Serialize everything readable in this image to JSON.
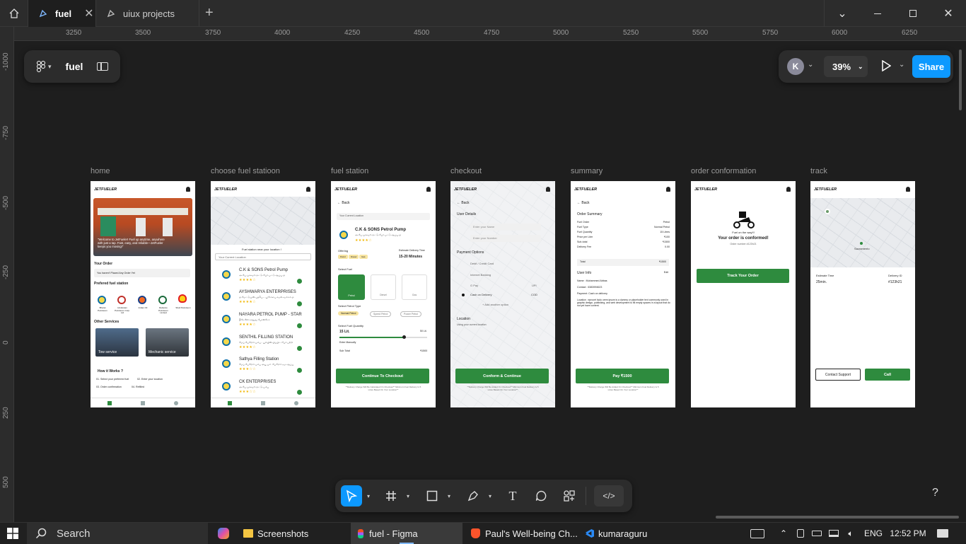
{
  "tabs": [
    {
      "label": "fuel"
    },
    {
      "label": "uiux projects"
    }
  ],
  "ruler": {
    "top": [
      "3250",
      "3500",
      "3750",
      "4000",
      "4250",
      "4500",
      "4750",
      "5000",
      "5250",
      "5500",
      "5750",
      "6000",
      "6250"
    ],
    "left": [
      "-1000",
      "-750",
      "-500",
      "-250",
      "0",
      "250",
      "500"
    ]
  },
  "file": {
    "name": "fuel"
  },
  "right_toolbar": {
    "avatar": "K",
    "zoom": "39%",
    "share": "Share"
  },
  "frames": [
    {
      "label": "home"
    },
    {
      "label": "choose fuel statioon"
    },
    {
      "label": "fuel station"
    },
    {
      "label": "checkout"
    },
    {
      "label": "summary"
    },
    {
      "label": "order conformation"
    },
    {
      "label": "track"
    }
  ],
  "brand": "JETFUELER",
  "home": {
    "hero": "\"Welcome to JetFueler! Fuel up anytime, anywhere with just a tap. Fast, easy, and reliable—JetFueler keeps you moving!\"",
    "your_order": "Your Order",
    "no_order": "You haven't Placed Any Order Yet",
    "preferred": "Prefered fuel station",
    "stations": [
      "Bharat Petroleum",
      "Hindustan Petroleum Corp. Ltd",
      "Indian Oil",
      "Reliance Petroleum Limited",
      "Shell Petroleum"
    ],
    "other": "Other Services",
    "tow": "Tow service",
    "mech": "Mechanic service",
    "how": "How it Works ?",
    "steps": [
      "01. Select your preferred fuel",
      "02. Enter your location",
      "03. Order confirmation",
      "04. Refilled"
    ]
  },
  "choose": {
    "subtitle": "Fuel station near your location !",
    "search": "Your Current Location",
    "list": [
      {
        "name": "C.K & SONS Petrol Pump",
        "addr": "அ.பே.முகவரி-ஒட்டு-பேர்.பட்டு.ஆப்பு.ஓ"
      },
      {
        "name": "AYSHWARYA ENTERPRISES",
        "addr": "ஓ.மேட்டுமுன்.பதபெ... பூசோபை.சுமல்.வம்சம்.ஓ"
      },
      {
        "name": "NAYARA PETROL PUMP - STAR",
        "addr": "நீரே-லோ.ஒதுஞ் போன்றோ"
      },
      {
        "name": "SENTHIL FILLING STATION",
        "addr": "மேப்.பேரோர்.பம்பு.. பூசியின்.பிப்பிட்.பேர்.பற்றி"
      },
      {
        "name": "Sathya Filling Station",
        "addr": "மேப்.பேரோர்.பம்பு அபூ.பம் .பேரோர்.ஏம.ஆப்பு"
      },
      {
        "name": "CK ENTERPRISES",
        "addr": "அ.பே.முகவரி-ஒட்டு-பம்பு"
      }
    ]
  },
  "station": {
    "back": "Back",
    "loc": "Your Current Location",
    "name": "C.K & SONS Petrol Pump",
    "addr": "அ.பே.முகவரி-ஒட்டு-பேர்.பட்டு.ஆப்பு.ஓ",
    "offering": "Offering",
    "offers": [
      "Petrol",
      "Diesel",
      "Gas"
    ],
    "est_label": "Estimate Delivery Time",
    "est": "15-20 Minutes",
    "select_fuel": "Select Fuel",
    "fuels": [
      "Petrol",
      "Diesel",
      "Gas"
    ],
    "select_type": "Select Petrol Type",
    "types": [
      "Normal Petrol",
      "Speed Petrol",
      "Power Petrol"
    ],
    "qty_label": "Select Fuel Quantity",
    "qty": "15 Lit.",
    "qty_max": "50 Lit.",
    "manual": "Enter Manually",
    "subtotal_label": "Sub Total",
    "subtotal": "₹1500",
    "cta": "Continue To Checkout",
    "note": "**Delivery Charge Will Be Calculated On Checkout** Minimum Fuel Delivery Is 5 Litres Based On Your Location**"
  },
  "checkout": {
    "back": "Back",
    "user": "User Details",
    "name_ph": "Enter your Name",
    "num_ph": "Enter your Number",
    "pay": "Payment Options",
    "options": [
      {
        "label": "Debit / Credit Card",
        "tag": ""
      },
      {
        "label": "Internet Banking",
        "tag": ""
      },
      {
        "label": "G Pay",
        "tag": "UPI"
      },
      {
        "label": "Cash on Delivery",
        "tag": "COD"
      }
    ],
    "add": "+ Add another option",
    "loc": "Location",
    "loc_sub": "Using your current location",
    "cta": "Conform & Continue",
    "note": "**Delivery Charge Will Be Added On Checkout** Minimum Fuel Delivery Is 5 Litres Based On Your Location**"
  },
  "summary": {
    "back": "Back",
    "title": "Order Summary",
    "rows": [
      [
        "Fuel Order",
        "Petrol"
      ],
      [
        "Fuel Type",
        "Normal Petrol"
      ],
      [
        "Fuel Quantity",
        "15 Litres"
      ],
      [
        "Price per Liter",
        "₹100"
      ],
      [
        "Sub-total",
        "₹1500"
      ],
      [
        "Delivery Fee",
        "0.00"
      ]
    ],
    "total_label": "Total",
    "total": "₹1500",
    "user": "User Info",
    "edit": "Edit",
    "user_name": "Name   :  Muhammed Abbas",
    "contact": "Contact  :  6383994623",
    "payment": "Payment: Cash on delivery",
    "location": "Location : eprocet Isolo orem ipsum is a dummy or placeholder text commonly used in graphic design, publishing, and web development to fill empty spaces in a layout that do not yet have content.",
    "cta": "Pay ₹1500",
    "note": "**Delivery Charge Will Be Added On Checkout** Minimum Fuel Delivery Is 5 Litres Based On Your Location**"
  },
  "confirm": {
    "on_way": "Fuel on the way!!!",
    "title": "Your order is conformed!",
    "order_no": "Order number #123h21",
    "cta": "Track Your Order"
  },
  "track": {
    "city": "Sacramento",
    "eta_label": "Estimate Time",
    "eta": "25min.",
    "id_label": "Delivery ID",
    "id": "#123h21",
    "support": "Contact Support",
    "call": "Call"
  },
  "taskbar": {
    "search": "Search",
    "apps": [
      "Screenshots",
      "fuel - Figma",
      "Paul's Well-being Ch...",
      "kumaraguru"
    ],
    "lang": "ENG",
    "time": "12:52 PM"
  },
  "help": "?"
}
